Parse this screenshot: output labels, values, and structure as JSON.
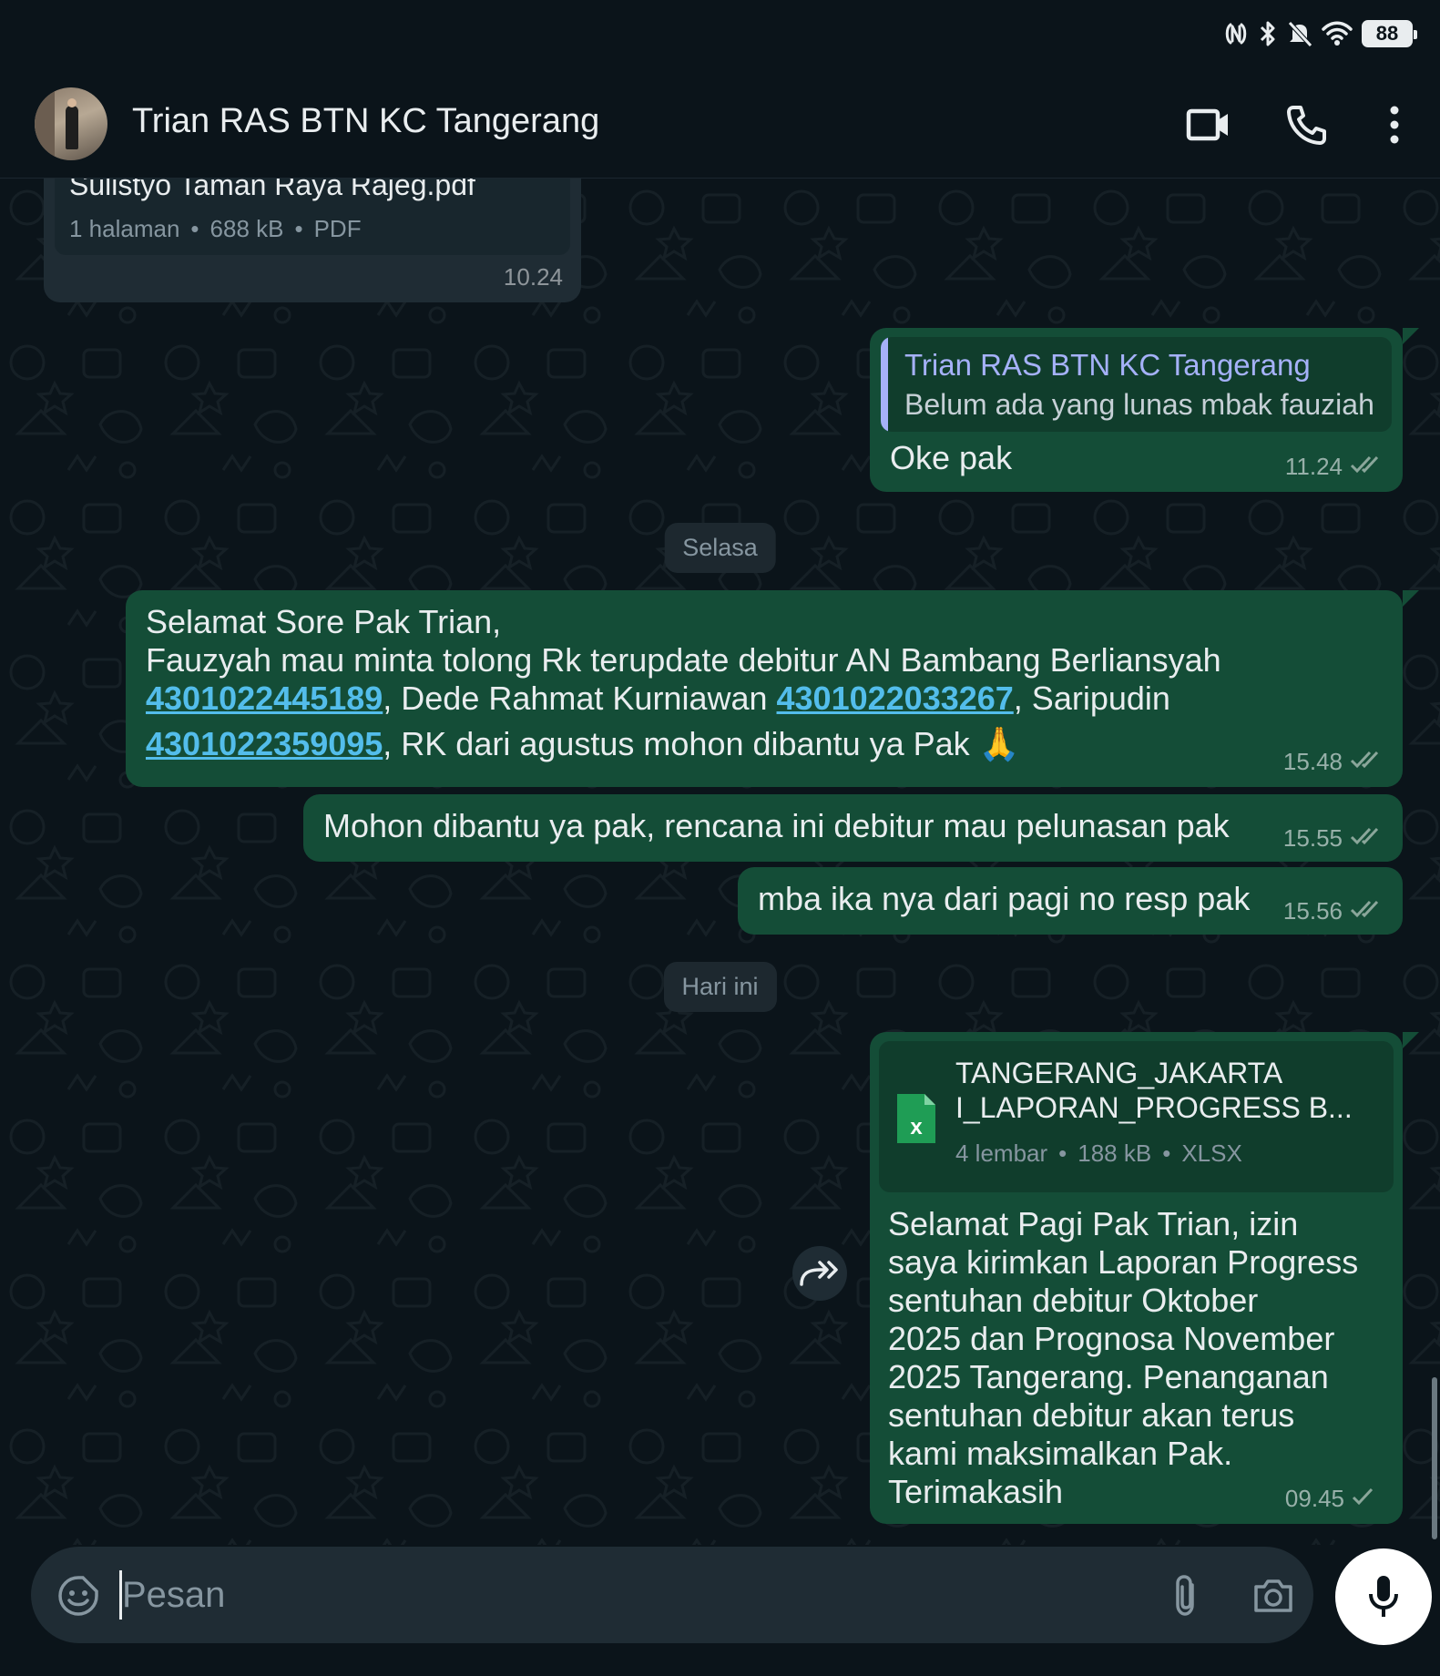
{
  "status_bar": {
    "battery": "88",
    "icons": [
      "nfc-icon",
      "bluetooth-icon",
      "bell-off-icon",
      "wifi-icon",
      "battery-icon"
    ]
  },
  "header": {
    "title": "Trian RAS BTN KC Tangerang",
    "icons": [
      "video-call-icon",
      "voice-call-icon",
      "more-menu-icon"
    ]
  },
  "messages": {
    "m1": {
      "direction": "incoming",
      "doc_name": "Sulistyo Taman Raya Rajeg.pdf",
      "doc_pages": "1 halaman",
      "doc_size": "688 kB",
      "doc_type": "PDF",
      "time": "10.24"
    },
    "m2": {
      "direction": "outgoing",
      "quote_author": "Trian RAS BTN KC Tangerang",
      "quote_text": "Belum ada yang lunas mbak fauziah",
      "text": "Oke pak",
      "time": "11.24",
      "status": "read"
    },
    "day1": "Selasa",
    "m3": {
      "direction": "outgoing",
      "line1": "Selamat Sore Pak Trian,",
      "line2": "Fauzyah mau minta tolong Rk terupdate debitur AN Bambang Berliansyah",
      "acc1": "4301022445189",
      "seg1": ", Dede Rahmat Kurniawan ",
      "acc2": "4301022033267",
      "seg2": ", Saripudin",
      "acc3": "4301022359095",
      "seg3": ", RK dari agustus mohon dibantu ya Pak",
      "emoji": "🙏",
      "time": "15.48",
      "status": "read"
    },
    "m4": {
      "direction": "outgoing",
      "text": "Mohon dibantu ya pak, rencana ini debitur mau pelunasan pak",
      "time": "15.55",
      "status": "read"
    },
    "m5": {
      "direction": "outgoing",
      "text": "mba ika nya dari pagi no resp pak",
      "time": "15.56",
      "status": "read"
    },
    "day2": "Hari ini",
    "m6": {
      "direction": "outgoing",
      "doc_name_line1": "TANGERANG_JAKARTA",
      "doc_name_line2": "I_LAPORAN_PROGRESS B...",
      "doc_sheets": "4 lembar",
      "doc_size": "188 kB",
      "doc_type": "XLSX",
      "text_lines": [
        "Selamat Pagi Pak Trian, izin",
        "saya kirimkan Laporan Progress",
        "sentuhan debitur Oktober",
        "2025 dan Prognosa November",
        "2025 Tangerang. Penanganan",
        "sentuhan debitur akan terus",
        "kami maksimalkan Pak.",
        "Terimakasih"
      ],
      "time": "09.45",
      "status": "sent"
    }
  },
  "input": {
    "placeholder": "Pesan",
    "icons": [
      "emoji-sticker-icon",
      "attach-icon",
      "camera-icon",
      "mic-icon"
    ]
  },
  "colors": {
    "background": "#0b141a",
    "outgoing_bubble": "#144d37",
    "incoming_bubble": "#1f2c34",
    "link": "#53bdeb",
    "quote_author": "#a5b1f8",
    "read_ticks": "#8aa69a"
  }
}
